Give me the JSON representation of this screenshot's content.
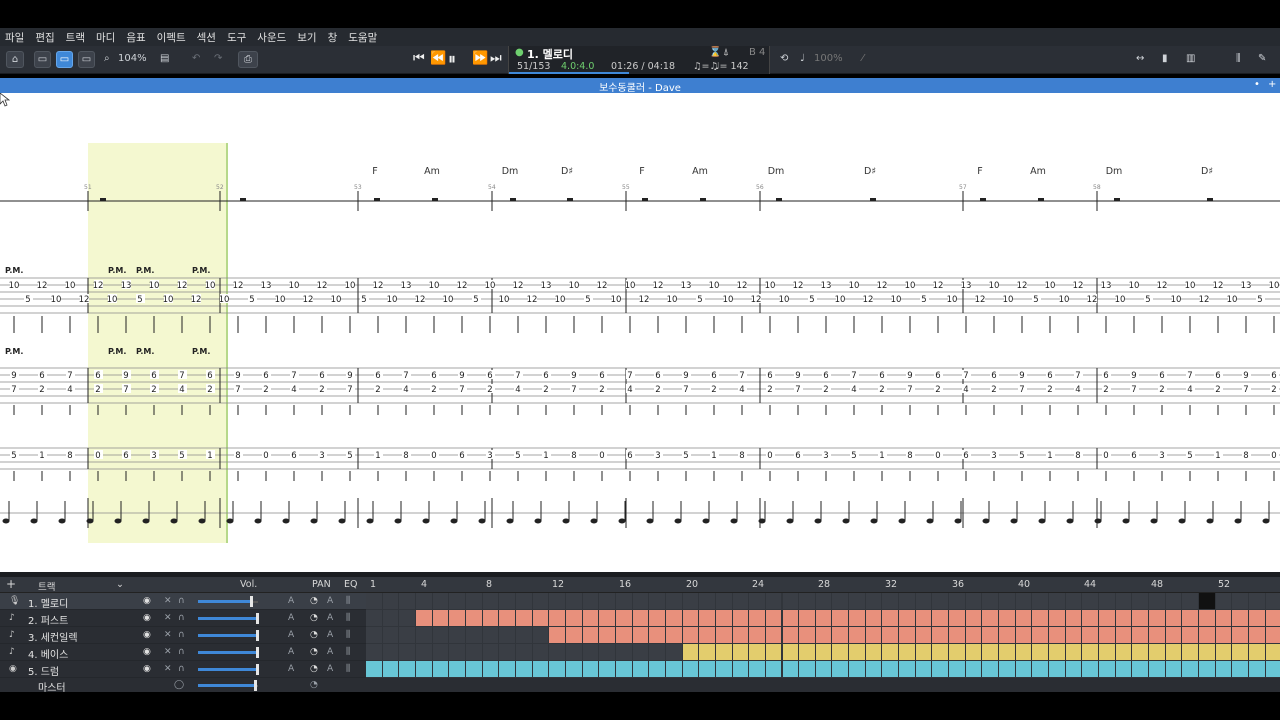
{
  "menu": [
    "파일",
    "편집",
    "트랙",
    "마디",
    "음표",
    "이펙트",
    "섹션",
    "도구",
    "사운드",
    "보기",
    "창",
    "도움말"
  ],
  "toolbar": {
    "zoom": "104%",
    "track_title": "1. 멜로디",
    "position": "51/153",
    "time_sig": "4.0:4.0",
    "time": "01:26 / 04:18",
    "tempo": "♩= 142",
    "volume_readout": "100%",
    "key": "B 4"
  },
  "document": {
    "title": "보수동쿨러 - Dave"
  },
  "score": {
    "measure_numbers": [
      "51",
      "52",
      "53",
      "54",
      "55",
      "56",
      "57",
      "58"
    ],
    "chords": [
      "F",
      "Am",
      "Dm",
      "D♯",
      "F",
      "Am",
      "Dm",
      "D♯",
      "F",
      "Am",
      "Dm",
      "D♯"
    ],
    "palm_mute": "P.M."
  },
  "track_panel": {
    "header_label": "트랙",
    "vol_label": "Vol.",
    "pan_label": "PAN",
    "eq_label": "EQ",
    "ruler": [
      "1",
      "4",
      "8",
      "12",
      "16",
      "20",
      "24",
      "28",
      "32",
      "36",
      "40",
      "44",
      "48",
      "52"
    ],
    "tracks": [
      {
        "name": "1. 멜로디",
        "icon": "microphone-icon",
        "vol": 0.9
      },
      {
        "name": "2. 퍼스트",
        "icon": "guitar-icon",
        "vol": 1.0
      },
      {
        "name": "3. 세컨일렉",
        "icon": "guitar-icon",
        "vol": 1.0
      },
      {
        "name": "4. 베이스",
        "icon": "bass-icon",
        "vol": 1.0
      },
      {
        "name": "5. 드럼",
        "icon": "drum-icon",
        "vol": 1.0
      }
    ],
    "master_label": "마스터",
    "colors": {
      "guitar": "#e8907c",
      "bass": "#e3cd6d",
      "drum": "#68c6d6",
      "accent": "#3f88d8"
    }
  }
}
